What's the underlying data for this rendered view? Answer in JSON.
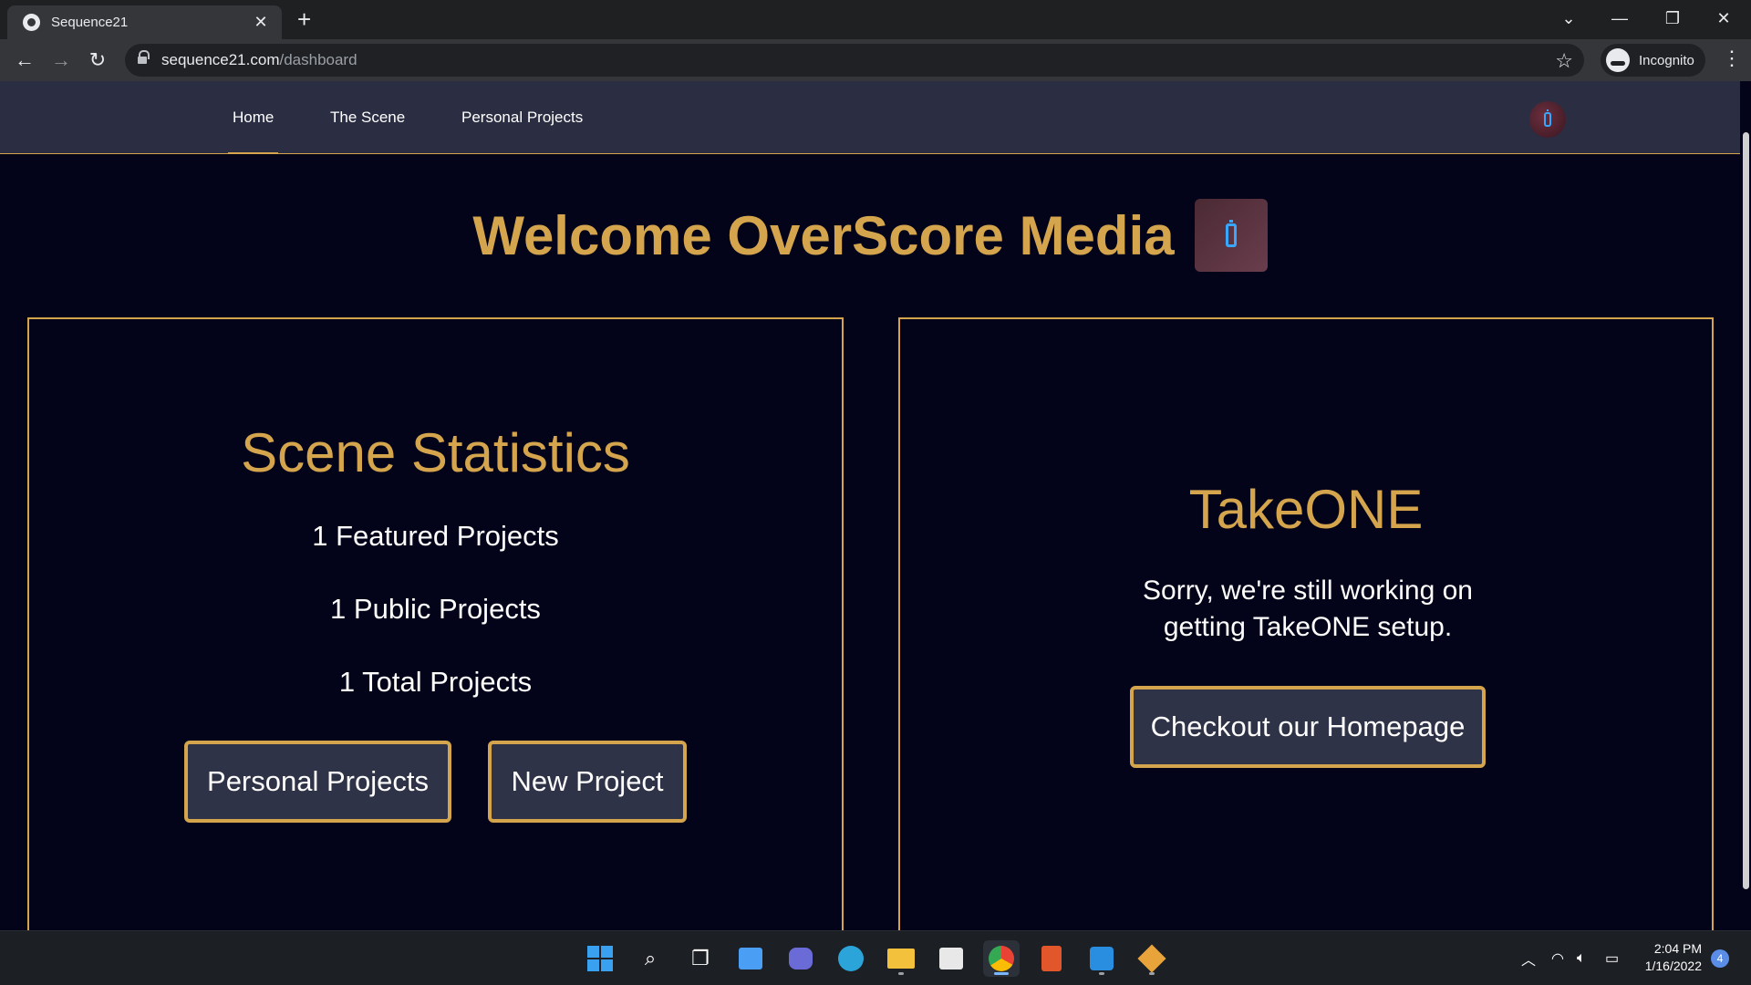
{
  "browser": {
    "tab_title": "Sequence21",
    "tab_close": "✕",
    "new_tab": "+",
    "url_host": "sequence21.com",
    "url_path": "/dashboard",
    "profile_label": "Incognito"
  },
  "navbar": {
    "links": [
      {
        "label": "Home",
        "active": true
      },
      {
        "label": "The Scene",
        "active": false
      },
      {
        "label": "Personal Projects",
        "active": false
      }
    ]
  },
  "welcome": {
    "heading": "Welcome OverScore Media"
  },
  "stats_panel": {
    "title": "Scene Statistics",
    "featured": "1 Featured Projects",
    "public": "1 Public Projects",
    "total": "1 Total Projects",
    "personal_button": "Personal Projects",
    "new_button": "New Project"
  },
  "takeone_panel": {
    "title": "TakeONE",
    "message": "Sorry, we're still working on getting TakeONE setup.",
    "button": "Checkout our Homepage"
  },
  "taskbar": {
    "time": "2:04 PM",
    "date": "1/16/2022",
    "notification_count": "4"
  },
  "colors": {
    "accent_gold": "#d5a54e",
    "page_background": "#03041a",
    "navbar_background": "#2b2d42",
    "button_background": "#2f3347"
  }
}
